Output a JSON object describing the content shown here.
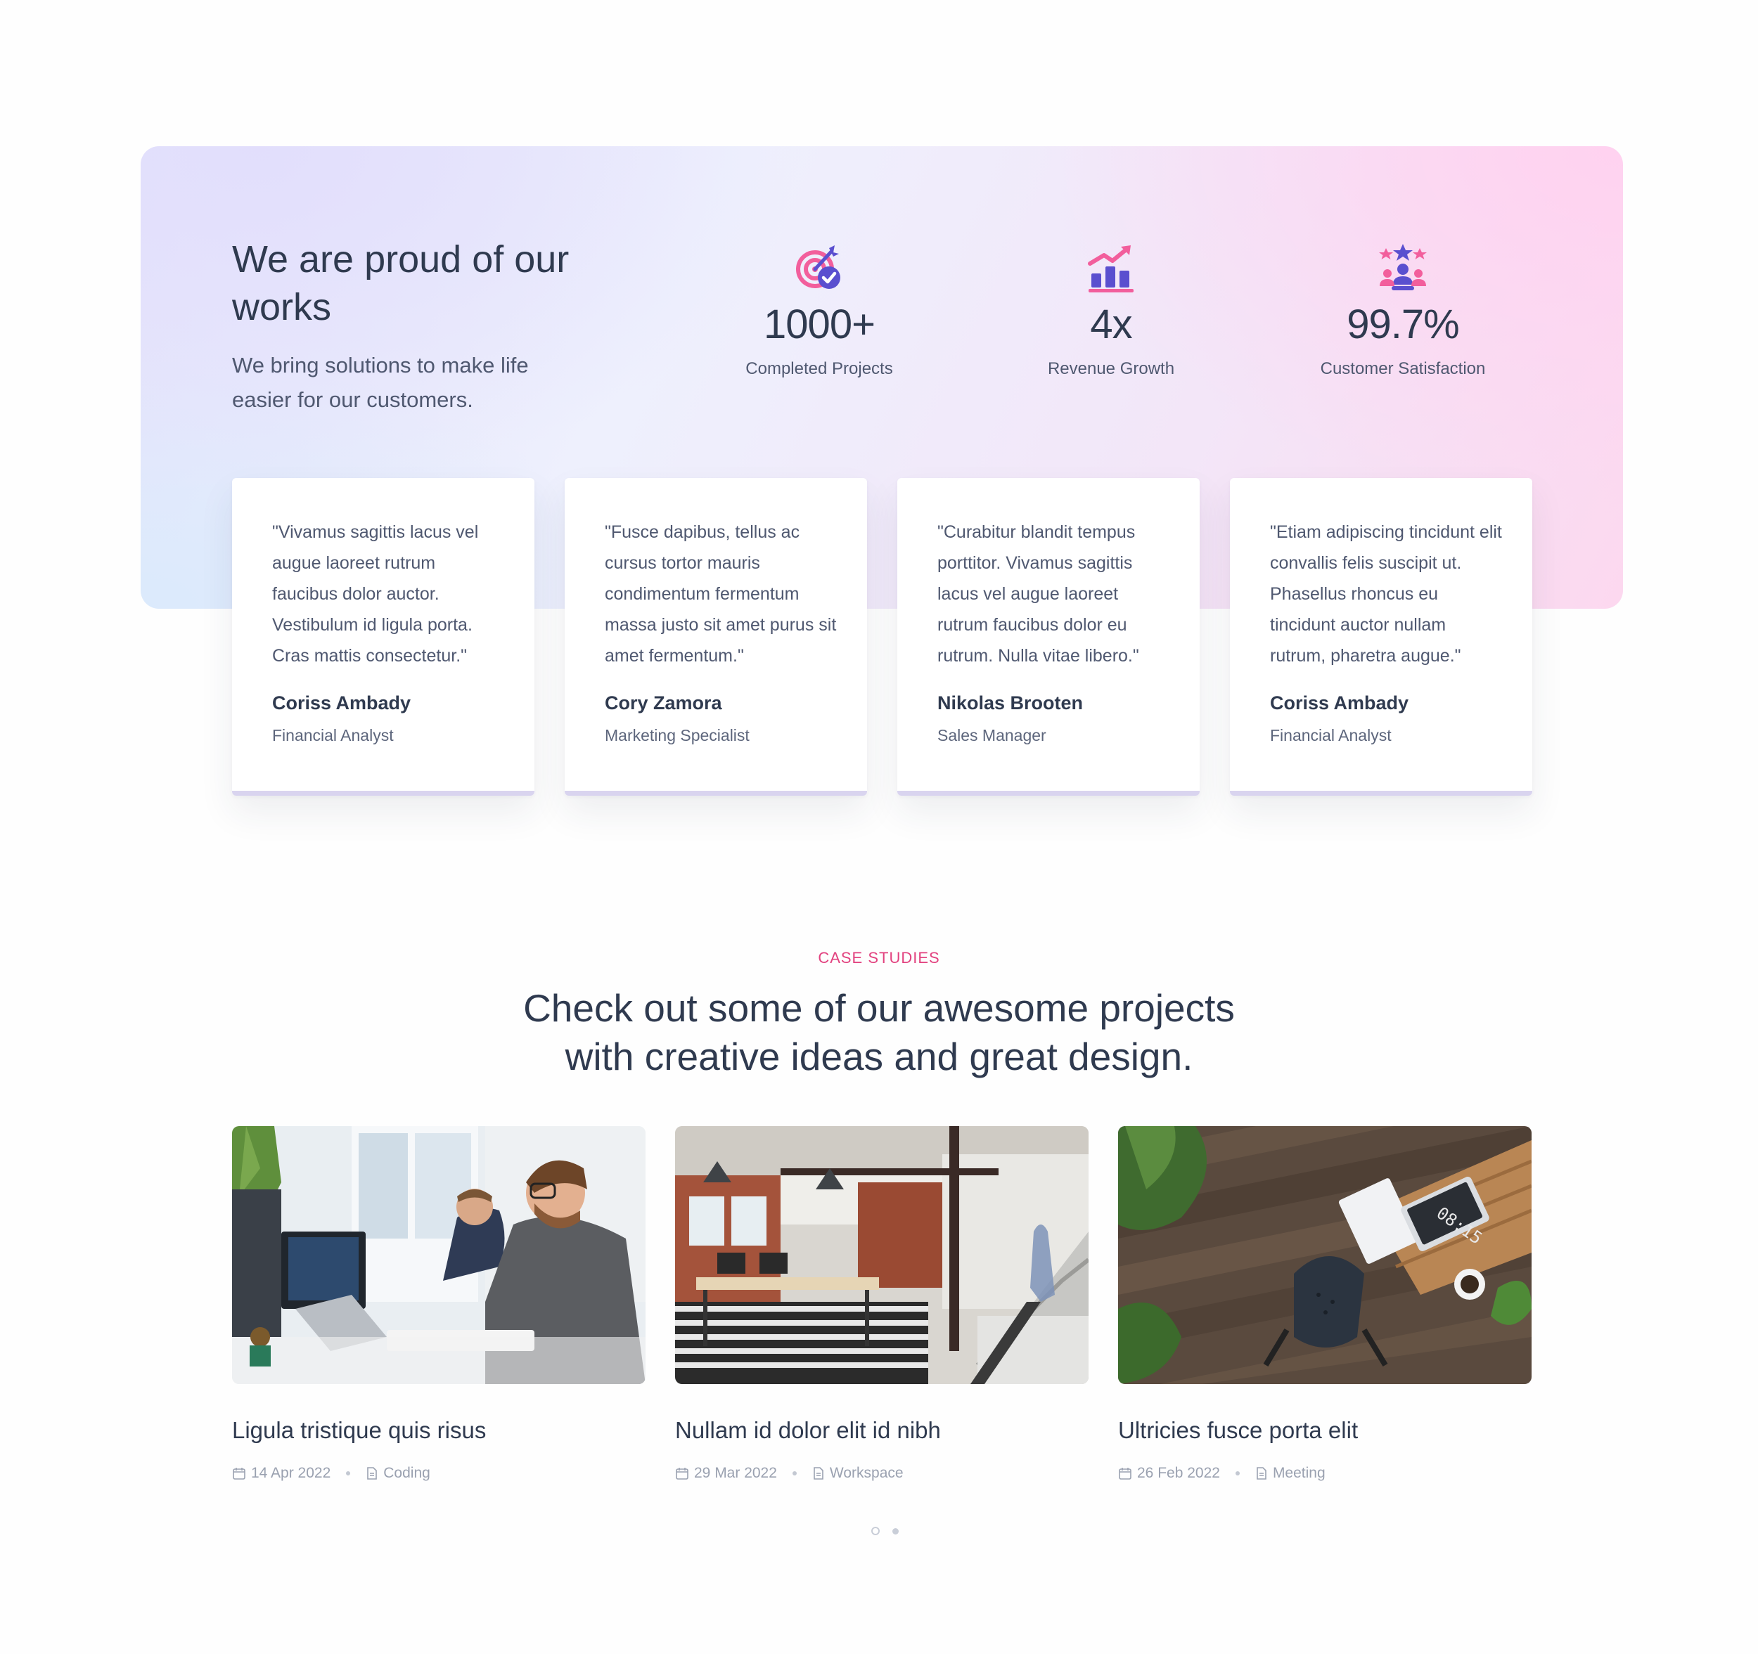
{
  "hero": {
    "title": "We are proud of our works",
    "subtitle": "We bring solutions to make life easier for our customers."
  },
  "stats": [
    {
      "icon": "target-check-icon",
      "value": "1000+",
      "label": "Completed Projects"
    },
    {
      "icon": "growth-chart-icon",
      "value": "4x",
      "label": "Revenue Growth"
    },
    {
      "icon": "team-stars-icon",
      "value": "99.7%",
      "label": "Customer Satisfaction"
    }
  ],
  "testimonials": [
    {
      "quote": "\"Vivamus sagittis lacus vel augue laoreet rutrum faucibus dolor auctor. Vestibulum id ligula porta. Cras mattis consectetur.\"",
      "name": "Coriss Ambady",
      "role": "Financial Analyst"
    },
    {
      "quote": "\"Fusce dapibus, tellus ac cursus tortor mauris condimentum fermentum massa justo sit amet purus sit amet fermentum.\"",
      "name": "Cory Zamora",
      "role": "Marketing Specialist"
    },
    {
      "quote": "\"Curabitur blandit tempus porttitor. Vivamus sagittis lacus vel augue laoreet rutrum faucibus dolor eu rutrum. Nulla vitae libero.\"",
      "name": "Nikolas Brooten",
      "role": "Sales Manager"
    },
    {
      "quote": "\"Etiam adipiscing tincidunt elit convallis felis suscipit ut. Phasellus rhoncus eu tincidunt auctor nullam rutrum, pharetra augue.\"",
      "name": "Coriss Ambady",
      "role": "Financial Analyst"
    }
  ],
  "case_studies": {
    "eyebrow": "CASE STUDIES",
    "headline_line1": "Check out some of our awesome projects",
    "headline_line2": "with creative ideas and great design.",
    "projects": [
      {
        "title": "Ligula tristique quis risus",
        "date": "14 Apr 2022",
        "category": "Coding",
        "image": "office-coding-photo"
      },
      {
        "title": "Nullam id dolor elit id nibh",
        "date": "29 Mar 2022",
        "category": "Workspace",
        "image": "loft-workspace-photo"
      },
      {
        "title": "Ultricies fusce porta elit",
        "date": "26 Feb 2022",
        "category": "Meeting",
        "image": "desk-overhead-photo"
      }
    ]
  },
  "pager": {
    "pages": 2,
    "active": 1
  },
  "colors": {
    "accent_pink": "#e2427f",
    "icon_purple": "#5a4fcf",
    "icon_pink": "#f25e9c",
    "heading": "#2f3a4f"
  }
}
